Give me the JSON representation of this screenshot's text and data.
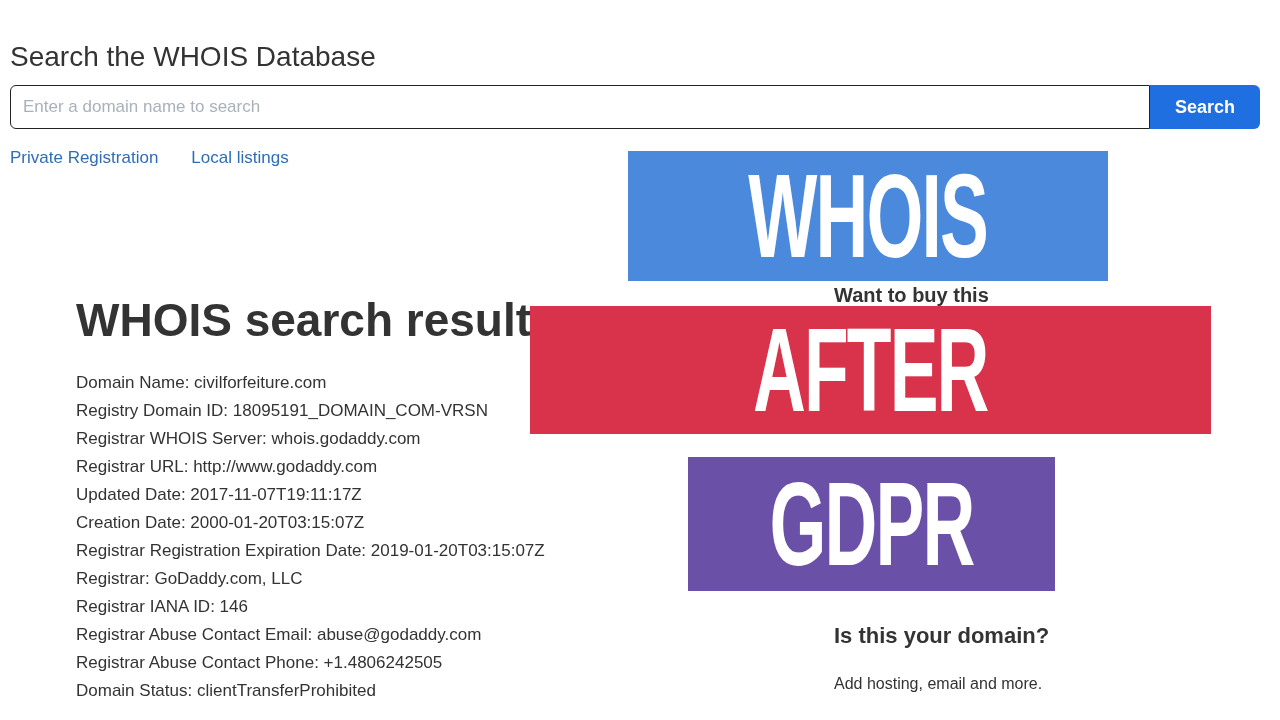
{
  "search": {
    "title": "Search the WHOIS Database",
    "placeholder": "Enter a domain name to search",
    "button": "Search",
    "links": [
      "Private Registration",
      "Local listings"
    ]
  },
  "results": {
    "title": "WHOIS search result",
    "lines": [
      "Domain Name: civilforfeiture.com",
      "Registry Domain ID: 18095191_DOMAIN_COM-VRSN",
      "Registrar WHOIS Server: whois.godaddy.com",
      "Registrar URL: http://www.godaddy.com",
      "Updated Date: 2017-11-07T19:11:17Z",
      "Creation Date: 2000-01-20T03:15:07Z",
      "Registrar Registration Expiration Date: 2019-01-20T03:15:07Z",
      "Registrar: GoDaddy.com, LLC",
      "Registrar IANA ID: 146",
      "Registrar Abuse Contact Email: abuse@godaddy.com",
      "Registrar Abuse Contact Phone: +1.4806242505",
      "Domain Status: clientTransferProhibited"
    ]
  },
  "sidebar": {
    "buy_title": "Want to buy this",
    "domain_title": "Is this your domain?",
    "domain_text": "Add hosting, email and more."
  },
  "banners": [
    {
      "text": "WHOIS",
      "color": "#4a89dc"
    },
    {
      "text": "AFTER",
      "color": "#d8334a"
    },
    {
      "text": "GDPR",
      "color": "#6a50a7"
    }
  ]
}
